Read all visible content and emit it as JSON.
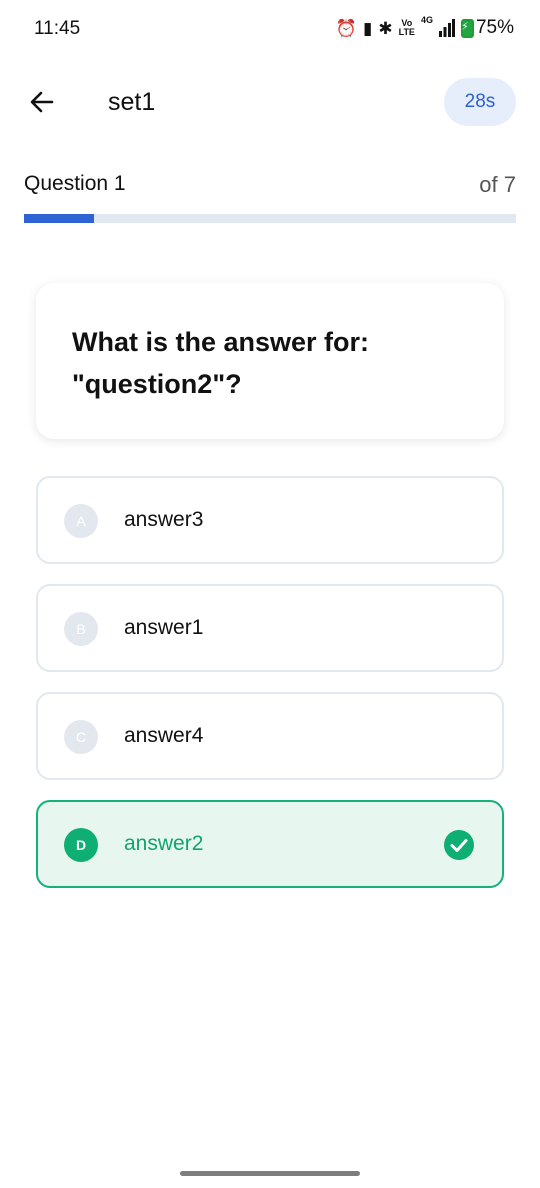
{
  "status_bar": {
    "time": "11:45",
    "volte_top": "Vo",
    "volte_bottom": "LTE",
    "network": "4G",
    "battery": "75%"
  },
  "header": {
    "title": "set1",
    "timer": "28s"
  },
  "progress": {
    "question_label": "Question 1",
    "total_label": "of 7",
    "fraction": 0.143
  },
  "question": {
    "text": "What is the answer for: \"question2\"?"
  },
  "options": [
    {
      "letter": "A",
      "text": "answer3",
      "selected": false
    },
    {
      "letter": "B",
      "text": "answer1",
      "selected": false
    },
    {
      "letter": "C",
      "text": "answer4",
      "selected": false
    },
    {
      "letter": "D",
      "text": "answer2",
      "selected": true
    }
  ],
  "colors": {
    "accent": "#2e63d6",
    "correct": "#16b07c",
    "correct_bg": "#e7f7f0"
  }
}
